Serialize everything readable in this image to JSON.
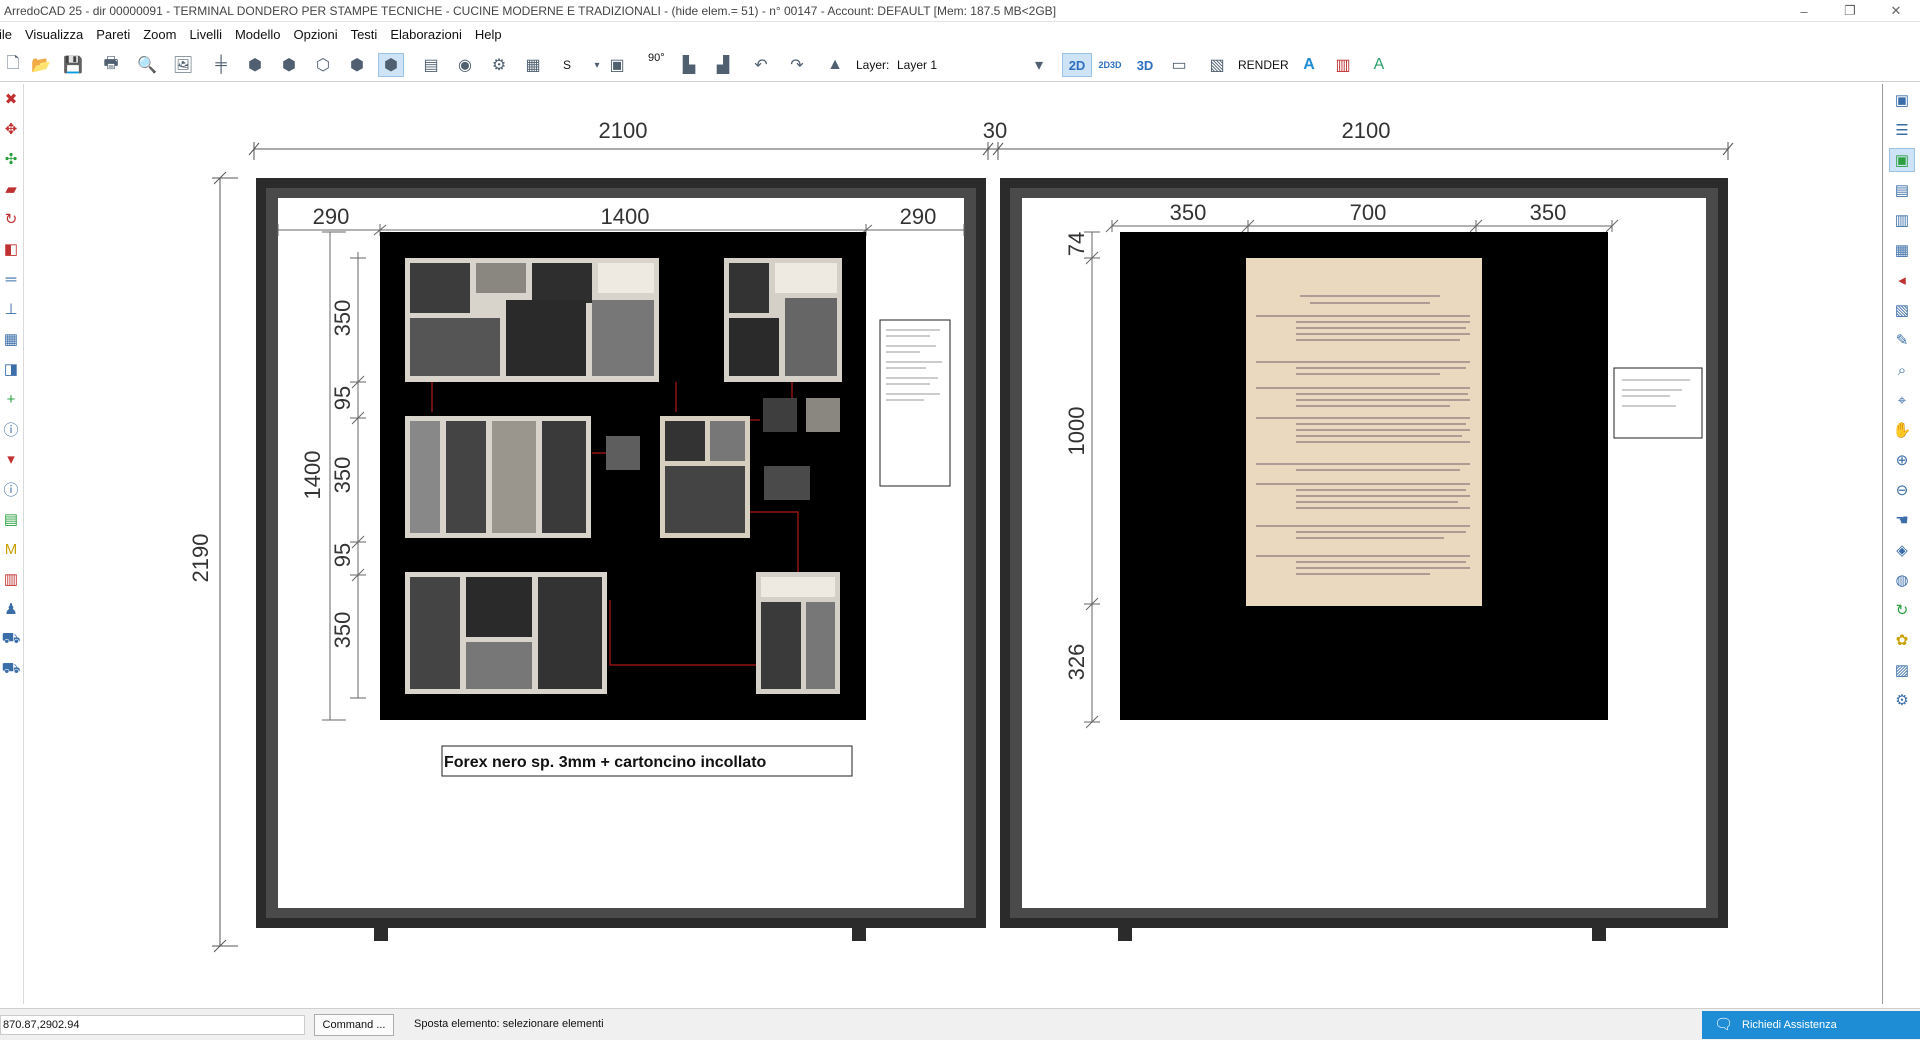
{
  "window": {
    "title": "ArredoCAD 25 - dir 00000091 - TERMINAL DONDERO PER STAMPE TECNICHE - CUCINE MODERNE E TRADIZIONALI - (hide elem.= 51)  - n° 00147 - Account: DEFAULT      [Mem: 187.5 MB<2GB]",
    "minimize": "–",
    "restore": "❐",
    "close": "✕"
  },
  "menu": [
    "File",
    "Visualizza",
    "Pareti",
    "Zoom",
    "Livelli",
    "Modello",
    "Opzioni",
    "Testi",
    "Elaborazioni",
    "Help"
  ],
  "toolbar": {
    "layer_label": "Layer:",
    "layer_value": "Layer 1",
    "s_label": "S",
    "angle_label": "90°",
    "view_2d": "2D",
    "view_2d3d": "2D3D",
    "view_3d": "3D",
    "render_label": "RENDER"
  },
  "drawing": {
    "dims": {
      "total_left": "2100",
      "gap": "30",
      "total_right": "2100",
      "height_total": "2190",
      "left_w1": "290",
      "left_w2": "1400",
      "left_w3": "290",
      "left_h": "1400",
      "left_h1": "350",
      "left_h2": "95",
      "left_h3": "350",
      "left_h4": "95",
      "left_h5": "350",
      "right_w1": "350",
      "right_w2": "700",
      "right_w3": "350",
      "right_h1": "74",
      "right_h2": "1000",
      "right_h3": "326"
    },
    "label_box": "Forex nero sp. 3mm + cartoncino incollato"
  },
  "status": {
    "coords": "870.87,2902.94",
    "command_button": "Command ...",
    "message": "Sposta elemento: selezionare elementi",
    "assist": "Richiedi Assistenza"
  },
  "colors": {
    "frame": "#2b2b2b",
    "panel": "#000000",
    "paper": "#ead9bf",
    "accent": "#1f8dd6",
    "connector": "#b01818"
  }
}
